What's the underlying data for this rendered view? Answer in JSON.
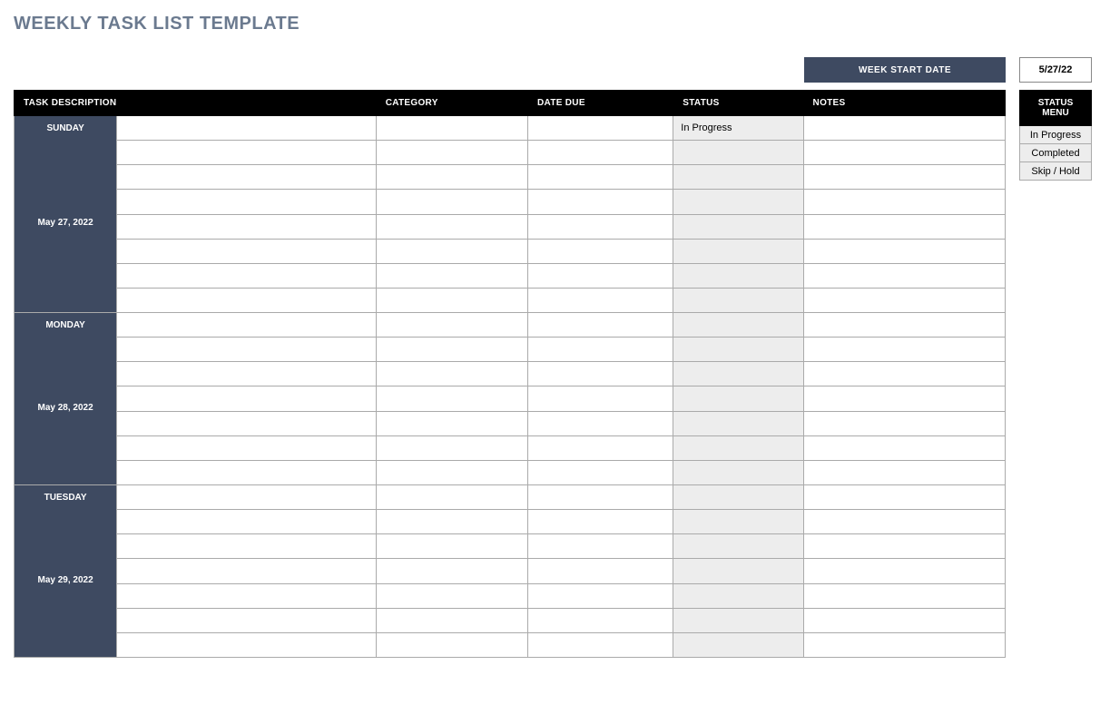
{
  "title": "WEEKLY TASK LIST TEMPLATE",
  "week_start_label": "WEEK START DATE",
  "week_start_date": "5/27/22",
  "columns": {
    "task": "TASK DESCRIPTION",
    "category": "CATEGORY",
    "due": "DATE DUE",
    "status": "STATUS",
    "notes": "NOTES"
  },
  "status_menu_header": "STATUS MENU",
  "status_menu": [
    "In Progress",
    "Completed",
    "Skip / Hold"
  ],
  "days": [
    {
      "name": "SUNDAY",
      "date": "May 27, 2022",
      "rows": [
        {
          "task": "",
          "category": "",
          "due": "",
          "status": "In Progress",
          "notes": ""
        },
        {
          "task": "",
          "category": "",
          "due": "",
          "status": "",
          "notes": ""
        },
        {
          "task": "",
          "category": "",
          "due": "",
          "status": "",
          "notes": ""
        },
        {
          "task": "",
          "category": "",
          "due": "",
          "status": "",
          "notes": ""
        },
        {
          "task": "",
          "category": "",
          "due": "",
          "status": "",
          "notes": ""
        },
        {
          "task": "",
          "category": "",
          "due": "",
          "status": "",
          "notes": ""
        },
        {
          "task": "",
          "category": "",
          "due": "",
          "status": "",
          "notes": ""
        },
        {
          "task": "",
          "category": "",
          "due": "",
          "status": "",
          "notes": ""
        }
      ]
    },
    {
      "name": "MONDAY",
      "date": "May 28, 2022",
      "rows": [
        {
          "task": "",
          "category": "",
          "due": "",
          "status": "",
          "notes": ""
        },
        {
          "task": "",
          "category": "",
          "due": "",
          "status": "",
          "notes": ""
        },
        {
          "task": "",
          "category": "",
          "due": "",
          "status": "",
          "notes": ""
        },
        {
          "task": "",
          "category": "",
          "due": "",
          "status": "",
          "notes": ""
        },
        {
          "task": "",
          "category": "",
          "due": "",
          "status": "",
          "notes": ""
        },
        {
          "task": "",
          "category": "",
          "due": "",
          "status": "",
          "notes": ""
        },
        {
          "task": "",
          "category": "",
          "due": "",
          "status": "",
          "notes": ""
        }
      ]
    },
    {
      "name": "TUESDAY",
      "date": "May 29, 2022",
      "rows": [
        {
          "task": "",
          "category": "",
          "due": "",
          "status": "",
          "notes": ""
        },
        {
          "task": "",
          "category": "",
          "due": "",
          "status": "",
          "notes": ""
        },
        {
          "task": "",
          "category": "",
          "due": "",
          "status": "",
          "notes": ""
        },
        {
          "task": "",
          "category": "",
          "due": "",
          "status": "",
          "notes": ""
        },
        {
          "task": "",
          "category": "",
          "due": "",
          "status": "",
          "notes": ""
        },
        {
          "task": "",
          "category": "",
          "due": "",
          "status": "",
          "notes": ""
        },
        {
          "task": "",
          "category": "",
          "due": "",
          "status": "",
          "notes": ""
        }
      ]
    }
  ]
}
